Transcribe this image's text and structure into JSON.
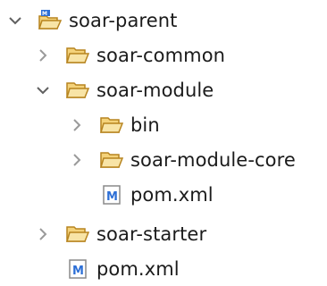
{
  "tree": {
    "items": [
      {
        "label": "soar-parent",
        "expanded": true,
        "icon": "maven-project-folder-icon",
        "depth": 0
      },
      {
        "label": "soar-common",
        "expanded": false,
        "icon": "folder-icon",
        "depth": 1
      },
      {
        "label": "soar-module",
        "expanded": true,
        "icon": "folder-icon",
        "depth": 1
      },
      {
        "label": "bin",
        "expanded": false,
        "icon": "folder-icon",
        "depth": 2
      },
      {
        "label": "soar-module-core",
        "expanded": false,
        "icon": "folder-icon",
        "depth": 2
      },
      {
        "label": "pom.xml",
        "icon": "maven-pom-file-icon",
        "depth": 2
      },
      {
        "label": "soar-starter",
        "expanded": false,
        "icon": "folder-icon",
        "depth": 1
      },
      {
        "label": "pom.xml",
        "icon": "maven-pom-file-icon",
        "depth": 1
      }
    ]
  },
  "colors": {
    "folder": "#e8b44a",
    "folder_stroke": "#b7841f",
    "chevron": "#606060",
    "maven_blue": "#2d6fd6"
  }
}
